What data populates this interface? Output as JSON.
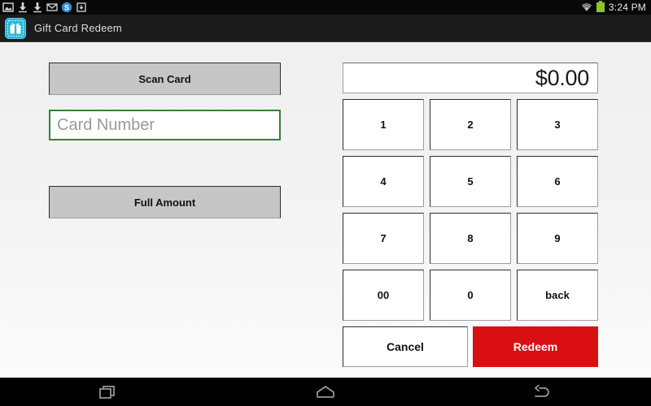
{
  "statusbar": {
    "icons": [
      {
        "name": "screenshot-icon"
      },
      {
        "name": "download-icon"
      },
      {
        "name": "download-icon"
      },
      {
        "name": "mail-icon"
      },
      {
        "name": "skype-icon"
      },
      {
        "name": "app-install-icon"
      }
    ],
    "wifi_icon": "wifi-icon",
    "battery_icon": "battery-icon",
    "battery_color": "#8cc429",
    "clock": "3:24 PM"
  },
  "actionbar": {
    "app_icon": "gift-card-icon",
    "app_icon_color": "#29b6da",
    "title": "Gift Card Redeem"
  },
  "left_panel": {
    "scan_card_label": "Scan Card",
    "card_number_value": "",
    "card_number_placeholder": "Card Number",
    "card_number_border_color": "#36803f",
    "full_amount_label": "Full Amount"
  },
  "right_panel": {
    "amount_display": "$0.00",
    "keys": [
      {
        "label": "1",
        "name": "key-1"
      },
      {
        "label": "2",
        "name": "key-2"
      },
      {
        "label": "3",
        "name": "key-3"
      },
      {
        "label": "4",
        "name": "key-4"
      },
      {
        "label": "5",
        "name": "key-5"
      },
      {
        "label": "6",
        "name": "key-6"
      },
      {
        "label": "7",
        "name": "key-7"
      },
      {
        "label": "8",
        "name": "key-8"
      },
      {
        "label": "9",
        "name": "key-9"
      },
      {
        "label": "00",
        "name": "key-double-zero"
      },
      {
        "label": "0",
        "name": "key-0"
      },
      {
        "label": "back",
        "name": "key-back"
      }
    ],
    "cancel_label": "Cancel",
    "redeem_label": "Redeem",
    "redeem_color": "#d90f13"
  },
  "navbar": {
    "recents_icon": "recents-icon",
    "home_icon": "home-icon",
    "back_icon": "back-icon"
  }
}
